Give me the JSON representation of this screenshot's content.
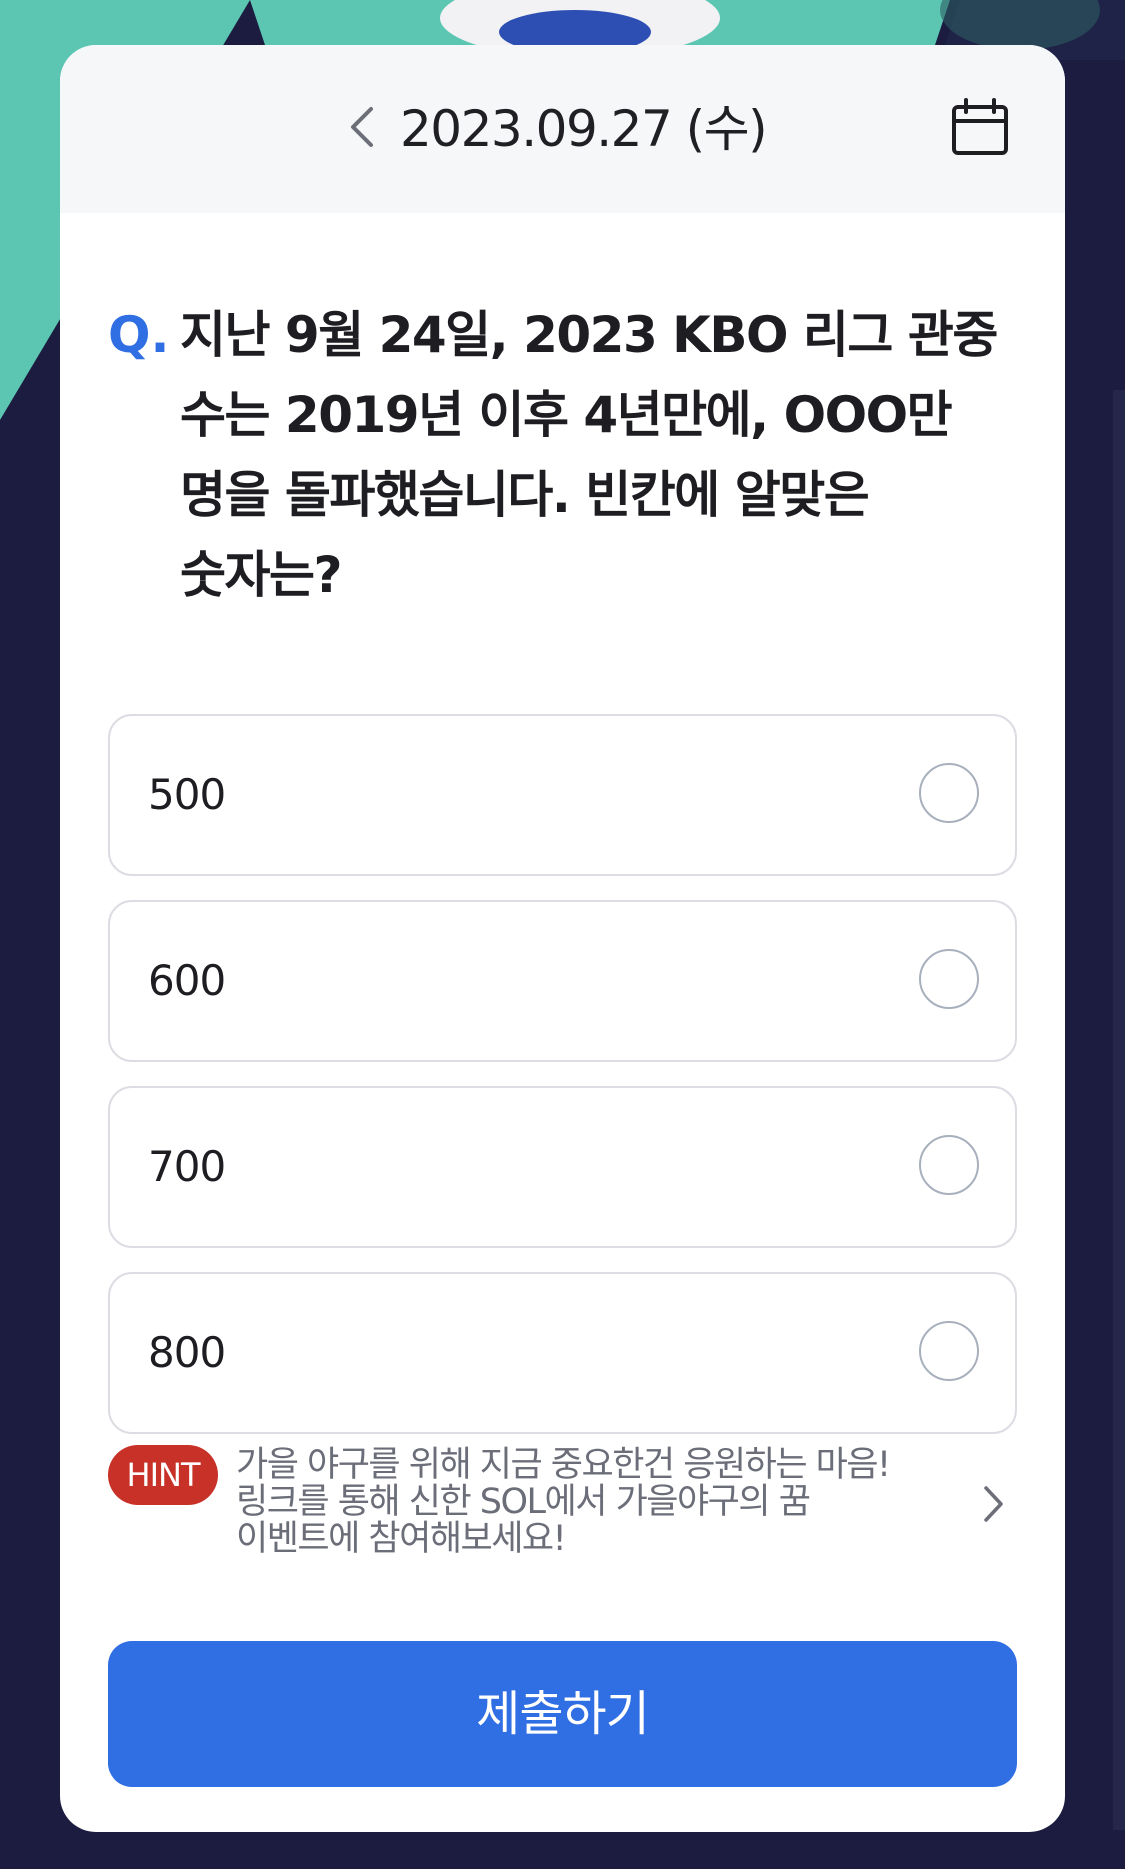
{
  "header": {
    "date": "2023.09.27 (수)",
    "prev_icon": "chevron-left-icon",
    "calendar_icon": "calendar-icon"
  },
  "question": {
    "prefix": "Q.",
    "text": "지난 9월 24일, 2023 KBO 리그 관중 수는 2019년 이후 4년만에, OOO만 명을 돌파했습니다. 빈칸에 알맞은 숫자는?"
  },
  "options": [
    {
      "label": "500",
      "selected": false
    },
    {
      "label": "600",
      "selected": false
    },
    {
      "label": "700",
      "selected": false
    },
    {
      "label": "800",
      "selected": false
    }
  ],
  "hint": {
    "badge": "HINT",
    "text": "가을 야구를 위해 지금 중요한건 응원하는 마음! 링크를 통해 신한 SOL에서 가을야구의 꿈 이벤트에 참여해보세요!",
    "chevron_icon": "chevron-right-icon"
  },
  "submit": {
    "label": "제출하기"
  },
  "colors": {
    "accent": "#2f6ee3",
    "hint_badge": "#c83127",
    "background": "#1b1c3f",
    "teal": "#5cc6b3"
  }
}
